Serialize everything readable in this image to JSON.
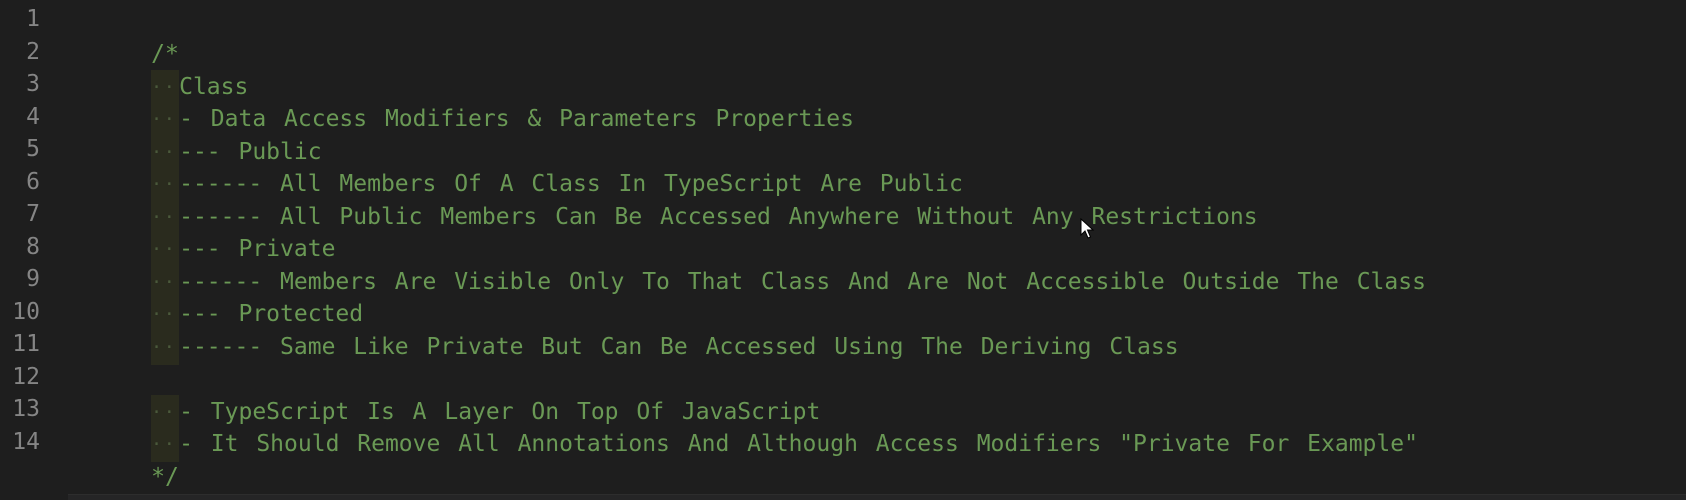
{
  "editor": {
    "lines": [
      {
        "number": "1",
        "indent": false,
        "text": "/*"
      },
      {
        "number": "2",
        "indent": true,
        "text": "Class"
      },
      {
        "number": "3",
        "indent": true,
        "text": "- Data Access Modifiers & Parameters Properties"
      },
      {
        "number": "4",
        "indent": true,
        "text": "--- Public"
      },
      {
        "number": "5",
        "indent": true,
        "text": "------ All Members Of A Class In TypeScript Are Public"
      },
      {
        "number": "6",
        "indent": true,
        "text": "------ All Public Members Can Be Accessed Anywhere Without Any Restrictions"
      },
      {
        "number": "7",
        "indent": true,
        "text": "--- Private"
      },
      {
        "number": "8",
        "indent": true,
        "text": "------ Members Are Visible Only To That Class And Are Not Accessible Outside The Class"
      },
      {
        "number": "9",
        "indent": true,
        "text": "--- Protected"
      },
      {
        "number": "10",
        "indent": true,
        "text": "------ Same Like Private But Can Be Accessed Using The Deriving Class"
      },
      {
        "number": "11",
        "indent": false,
        "text": ""
      },
      {
        "number": "12",
        "indent": true,
        "text": "- TypeScript Is A Layer On Top Of JavaScript"
      },
      {
        "number": "13",
        "indent": true,
        "text": "- It Should Remove All Annotations And Although Access Modifiers \"Private For Example\""
      },
      {
        "number": "14",
        "indent": false,
        "text": "*/"
      }
    ],
    "indent_marker": "··",
    "colors": {
      "background": "#1e1e1e",
      "comment": "#6a9955",
      "line_number": "#858585"
    }
  },
  "cursor": {
    "icon": "mouse-pointer-icon"
  }
}
